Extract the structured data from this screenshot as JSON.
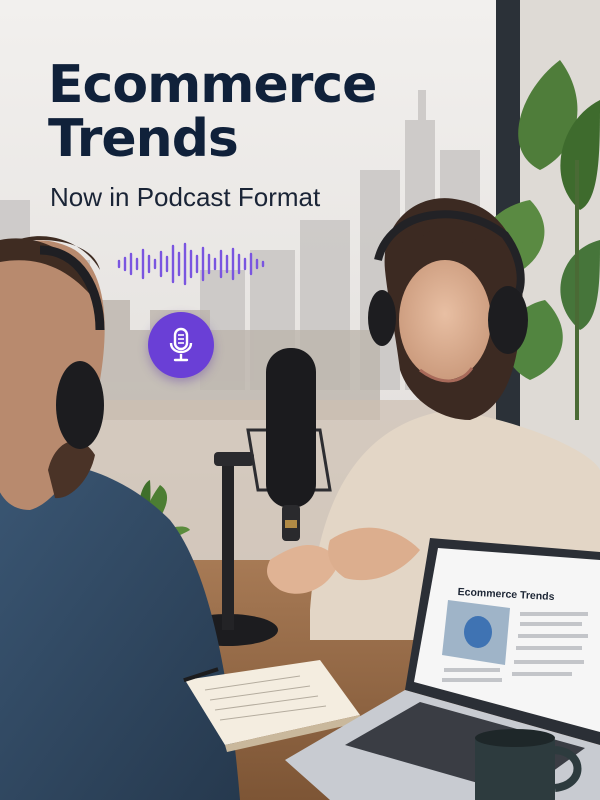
{
  "headline": {
    "line1": "Ecommerce",
    "line2": "Trends"
  },
  "subheadline": "Now in Podcast Format",
  "icons": {
    "audio_wave": "sound-wave-icon",
    "microphone": "microphone-icon"
  },
  "laptop_screen": {
    "article_title": "Ecommerce Trends"
  },
  "colors": {
    "headline": "#10213a",
    "accent_purple": "#6a3fd6",
    "wave_purple": "#7a55e0"
  }
}
